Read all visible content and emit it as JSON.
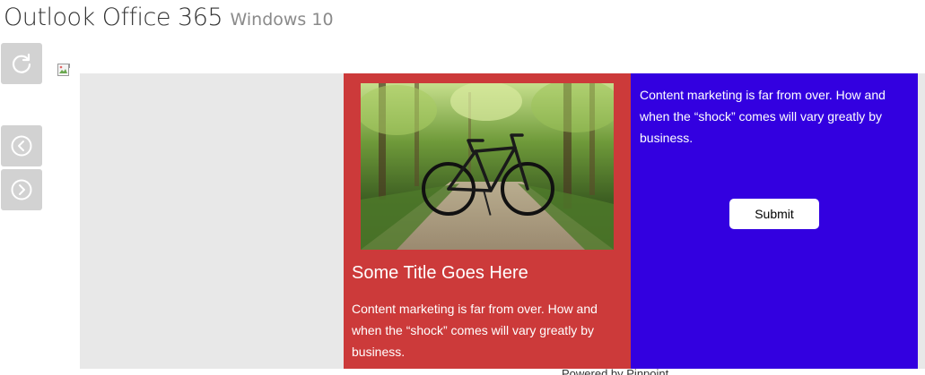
{
  "header": {
    "title": "Outlook Office 365",
    "platform": "Windows 10"
  },
  "controls": {
    "refresh_icon": "refresh-icon",
    "prev_icon": "chevron-left-circle-icon",
    "next_icon": "chevron-right-circle-icon"
  },
  "email": {
    "image_card": {
      "title": "Some Title Goes Here",
      "text": "Content marketing is far from over. How and when the “shock” comes will vary greatly by business."
    },
    "text_card": {
      "text": "Content marketing is far from over. How and when the “shock” comes will vary greatly by business.",
      "button_label": "Submit"
    },
    "footer": "Powered by Pinpoint"
  },
  "colors": {
    "image_card_bg": "#cc3a3a",
    "text_card_bg": "#3300e0",
    "canvas_bg": "#e8e8e8",
    "control_bg": "#d2d2d2"
  }
}
